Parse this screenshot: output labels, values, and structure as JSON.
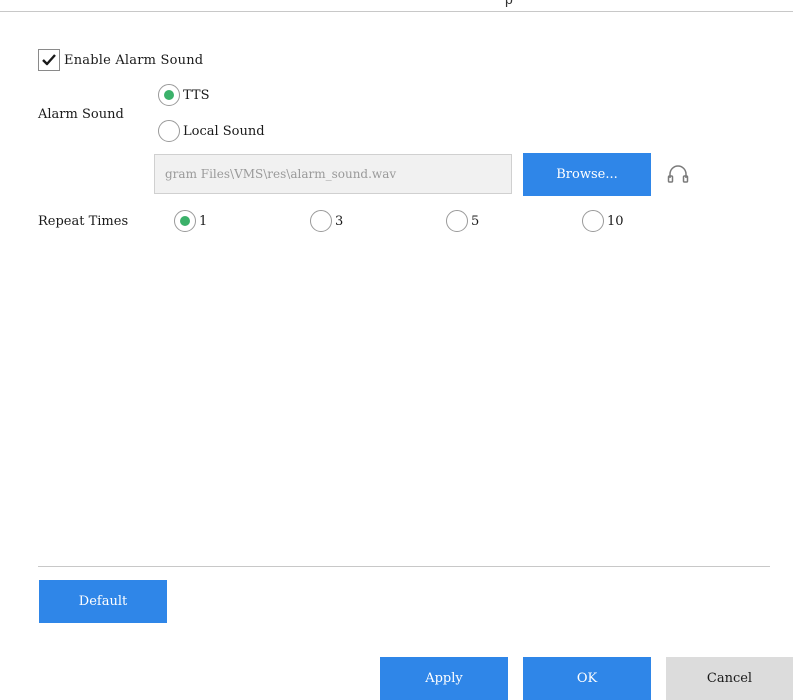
{
  "header": {
    "title_fragment": "p"
  },
  "enable_alarm": {
    "label": "Enable Alarm Sound",
    "checked": true
  },
  "alarm_sound": {
    "label": "Alarm Sound",
    "options": [
      {
        "label": "TTS",
        "selected": true
      },
      {
        "label": "Local Sound",
        "selected": false
      }
    ],
    "file_path": "gram Files\\VMS\\res\\alarm_sound.wav",
    "browse_label": "Browse..."
  },
  "repeat_times": {
    "label": "Repeat Times",
    "options": [
      {
        "label": "1",
        "selected": true
      },
      {
        "label": "3",
        "selected": false
      },
      {
        "label": "5",
        "selected": false
      },
      {
        "label": "10",
        "selected": false
      }
    ]
  },
  "footer": {
    "default_label": "Default",
    "apply_label": "Apply",
    "ok_label": "OK",
    "cancel_label": "Cancel"
  },
  "colors": {
    "accent": "#2f86e8",
    "radio_selected": "#3bb16a",
    "cancel_bg": "#dcdcdc"
  },
  "icons": [
    "check-icon",
    "headphone-icon"
  ]
}
